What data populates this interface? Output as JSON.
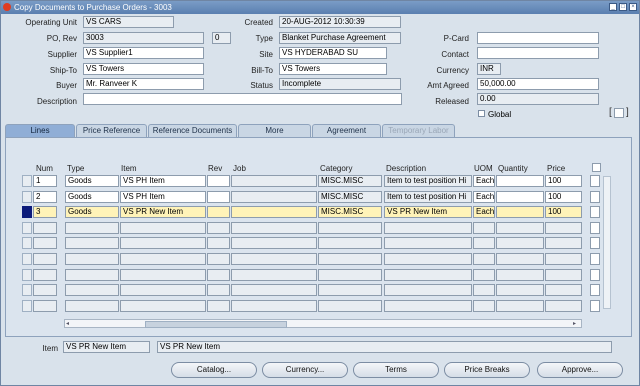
{
  "window": {
    "title": "Copy Documents to Purchase Orders - 3003"
  },
  "header": {
    "operating_unit_label": "Operating Unit",
    "operating_unit": "VS CARS",
    "created_label": "Created",
    "created": "20-AUG-2012 10:30:39",
    "po_rev_label": "PO, Rev",
    "po": "3003",
    "rev": "0",
    "type_label": "Type",
    "type": "Blanket Purchase Agreement",
    "pcard_label": "P-Card",
    "pcard": "",
    "supplier_label": "Supplier",
    "supplier": "VS Supplier1",
    "site_label": "Site",
    "site": "VS HYDERABAD SU",
    "contact_label": "Contact",
    "contact": "",
    "shipto_label": "Ship-To",
    "shipto": "VS Towers",
    "billto_label": "Bill-To",
    "billto": "VS Towers",
    "currency_label": "Currency",
    "currency": "INR",
    "buyer_label": "Buyer",
    "buyer": "Mr. Ranveer K",
    "status_label": "Status",
    "status": "Incomplete",
    "amt_agreed_label": "Amt Agreed",
    "amt_agreed": "50,000.00",
    "description_label": "Description",
    "description": "",
    "released_label": "Released",
    "released": "0.00",
    "global_label": "Global"
  },
  "tabs": [
    "Lines",
    "Price Reference",
    "Reference Documents",
    "More",
    "Agreement",
    "Temporary Labor"
  ],
  "columns": [
    "Num",
    "Type",
    "Item",
    "Rev",
    "Job",
    "Category",
    "Description",
    "UOM",
    "Quantity",
    "Price"
  ],
  "rows": [
    {
      "num": "1",
      "type": "Goods",
      "item": "VS PH Item",
      "rev": "",
      "job": "",
      "category": "MISC.MISC",
      "description": "Item to test position Hi",
      "uom": "Each",
      "quantity": "",
      "price": "100"
    },
    {
      "num": "2",
      "type": "Goods",
      "item": "VS PH Item",
      "rev": "",
      "job": "",
      "category": "MISC.MISC",
      "description": "Item to test position Hi",
      "uom": "Each",
      "quantity": "",
      "price": "100"
    },
    {
      "num": "3",
      "type": "Goods",
      "item": "VS PR New Item",
      "rev": "",
      "job": "",
      "category": "MISC.MISC",
      "description": "VS PR New Item",
      "uom": "Each",
      "quantity": "",
      "price": "100"
    }
  ],
  "footer": {
    "item_label": "Item",
    "item_code": "VS PR New Item",
    "item_desc": "VS PR New Item"
  },
  "buttons": {
    "catalog": "Catalog...",
    "currency": "Currency...",
    "terms": "Terms",
    "price_breaks": "Price Breaks",
    "approve": "Approve..."
  },
  "icons": {
    "app": "oracle-icon",
    "minimize": "minimize-icon",
    "maximize": "maximize-icon",
    "close": "close-icon"
  },
  "colors": {
    "selected_row": "#fff3b8",
    "active_tab": "#90aed6",
    "titlebar": "#5a7fb0"
  }
}
